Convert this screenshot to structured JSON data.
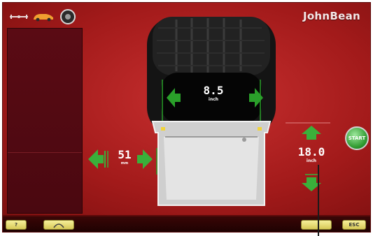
{
  "header": {
    "brand": "JohnBean"
  },
  "top_icons": [
    "wheel-weight-icon",
    "car-icon",
    "wheel-icon"
  ],
  "tire_width": {
    "value": "8.5",
    "unit": "inch"
  },
  "offset": {
    "value": "51",
    "unit": "mm"
  },
  "diameter": {
    "value": "18.0",
    "unit": "inch"
  },
  "start_button": {
    "label": "START"
  },
  "bottom_bar": {
    "help_label": "?",
    "home_icon": "home-icon",
    "esc_label": "ESC"
  },
  "colors": {
    "background": "#a21a1a",
    "accent_green": "#3aa83a",
    "button_yellow": "#e8dc7a"
  }
}
